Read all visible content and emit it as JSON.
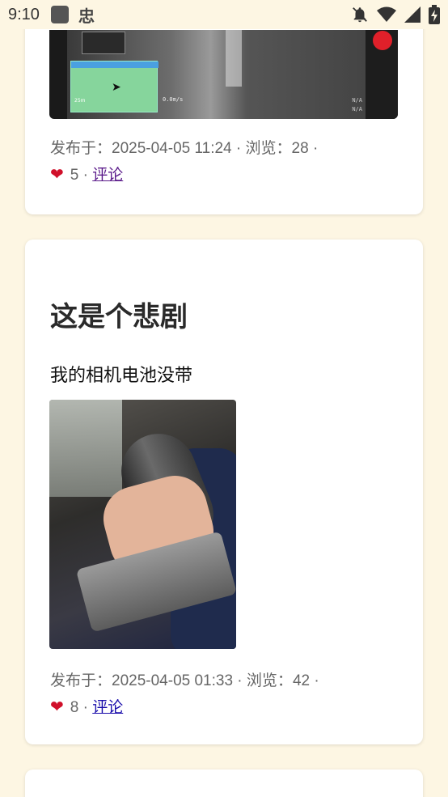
{
  "status_bar": {
    "time": "9:10",
    "icons": [
      "app-square-icon",
      "app-glyph-icon",
      "notifications-off-icon",
      "wifi-icon",
      "signal-icon",
      "battery-charging-icon"
    ],
    "app_glyph": "忠"
  },
  "posts": [
    {
      "meta": {
        "published_label": "发布于：",
        "published_at": "2025-04-05 11:24",
        "views_label": "浏览：",
        "views": "28",
        "likes": "5",
        "comments_label": "评论"
      },
      "image_overlay": {
        "telemetry": "0.0m/s",
        "na_label": "N/A",
        "map_scale": "25m"
      }
    },
    {
      "title": "这是个悲剧",
      "body": "我的相机电池没带",
      "meta": {
        "published_label": "发布于：",
        "published_at": "2025-04-05 01:33",
        "views_label": "浏览：",
        "views": "42",
        "likes": "8",
        "comments_label": "评论"
      }
    }
  ],
  "colors": {
    "background": "#fdf6e3",
    "card": "#ffffff",
    "heart": "#d0102a",
    "link": "#1a0dab",
    "link_visited": "#5a1a8a"
  }
}
